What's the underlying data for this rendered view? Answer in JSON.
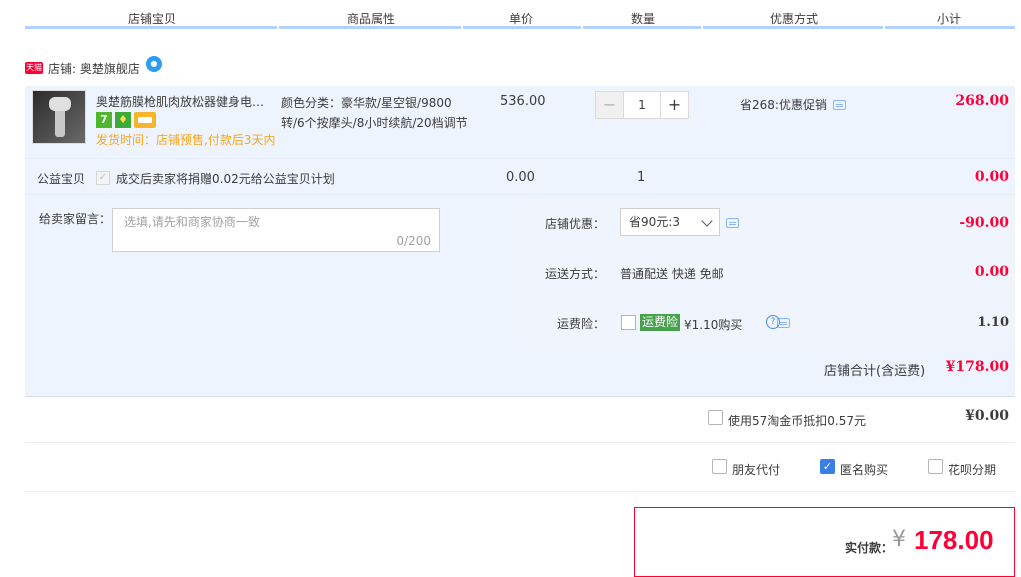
{
  "header": {
    "columns": [
      "店铺宝贝",
      "商品属性",
      "单价",
      "数量",
      "优惠方式",
      "小计"
    ]
  },
  "shop": {
    "badge": "天猫",
    "label": "店铺: 奥楚旗舰店"
  },
  "item": {
    "title": "奥楚筋膜枪肌肉放松器健身电动按摩",
    "icon_7": "7",
    "ship_text": "发货时间：店铺预售,付款后3天内",
    "attrs": "颜色分类：豪华款/星空银/9800转/6个按摩头/8小时续航/20档调节",
    "price": "536.00",
    "quantity": "1",
    "minus": "−",
    "plus": "+",
    "promo": "省268:优惠促销",
    "subtotal": "268.00"
  },
  "charity": {
    "label": "公益宝贝",
    "text": "成交后卖家将捐赠0.02元给公益宝贝计划",
    "price": "0.00",
    "qty": "1",
    "subtotal": "0.00"
  },
  "message": {
    "label": "给卖家留言：",
    "placeholder": "选填,请先和商家协商一致",
    "count": "0/200"
  },
  "shop_discount": {
    "label": "店铺优惠：",
    "value": "省90元:3",
    "amount": "-90.00"
  },
  "shipping": {
    "label": "运送方式：",
    "value": "普通配送 快递 免邮",
    "amount": "0.00"
  },
  "insurance": {
    "label": "运费险：",
    "tag": "运费险",
    "price": "¥1.10购买",
    "amount": "1.10"
  },
  "shop_total": {
    "label": "店铺合计(含运费)",
    "amount": "¥178.00"
  },
  "coins": {
    "text": "使用57淘金币抵扣0.57元",
    "amount": "¥0.00"
  },
  "options": {
    "friend_pay": "朋友代付",
    "anonymous": "匿名购买",
    "huabei": "花呗分期"
  },
  "payment": {
    "label": "实付款：",
    "currency": "¥",
    "amount": "178.00"
  },
  "colors": {
    "accent_red": "#ff0036",
    "header_bar": "#b2d1ff",
    "panel_bg": "#eef4fd",
    "check_blue": "#3a7ee8"
  }
}
